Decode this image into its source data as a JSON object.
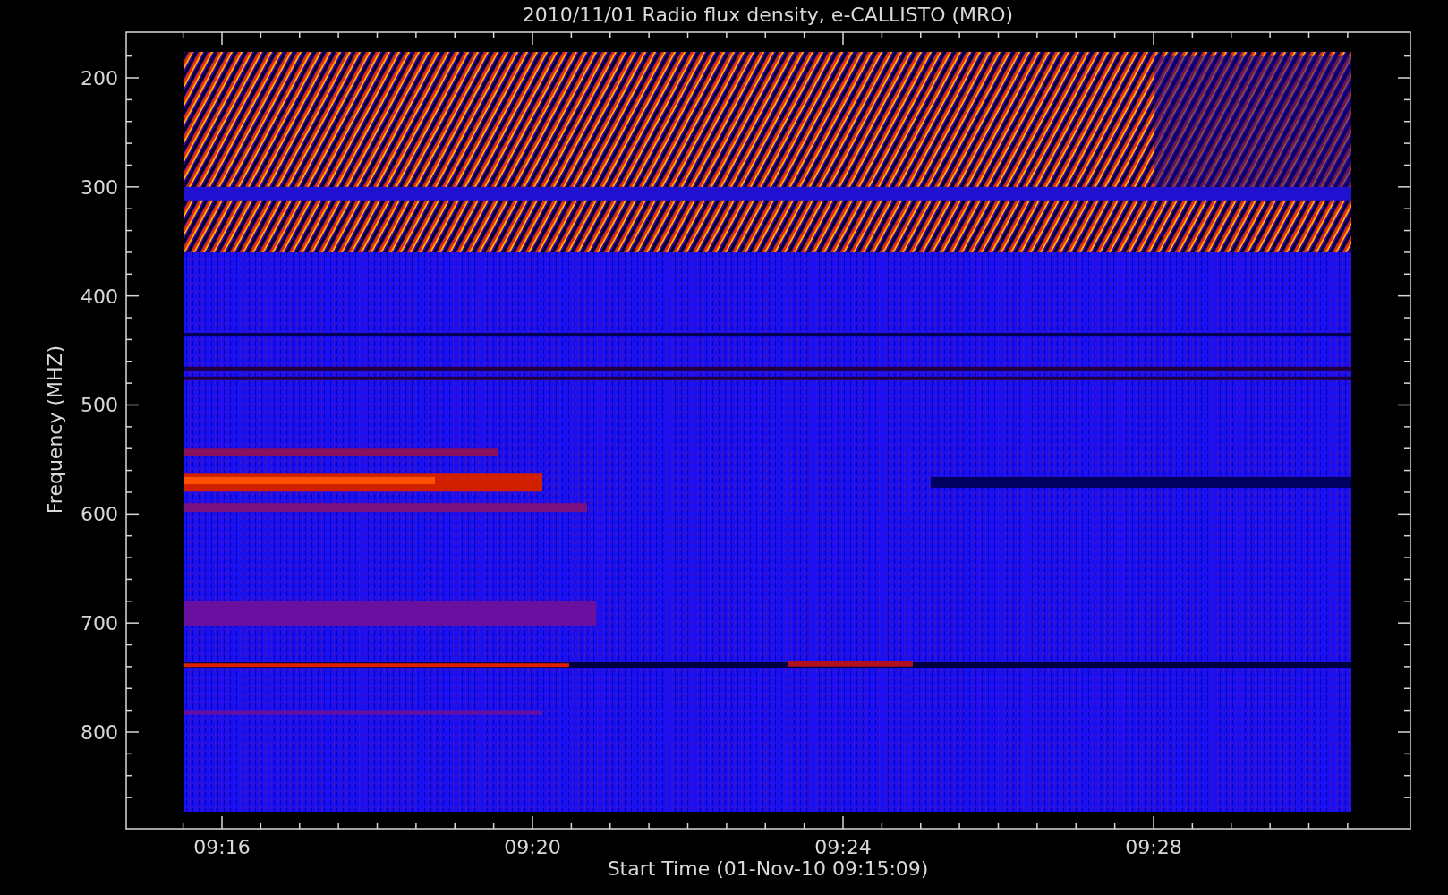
{
  "title": "2010/11/01  Radio flux density, e-CALLISTO (MRO)",
  "y_axis": {
    "label": "Frequency (MHZ)",
    "ticks": [
      "200",
      "300",
      "400",
      "500",
      "600",
      "700",
      "800"
    ]
  },
  "x_axis": {
    "label": "Start Time (01-Nov-10 09:15:09)",
    "ticks": [
      "09:16",
      "09:20",
      "09:24",
      "09:28"
    ]
  }
}
